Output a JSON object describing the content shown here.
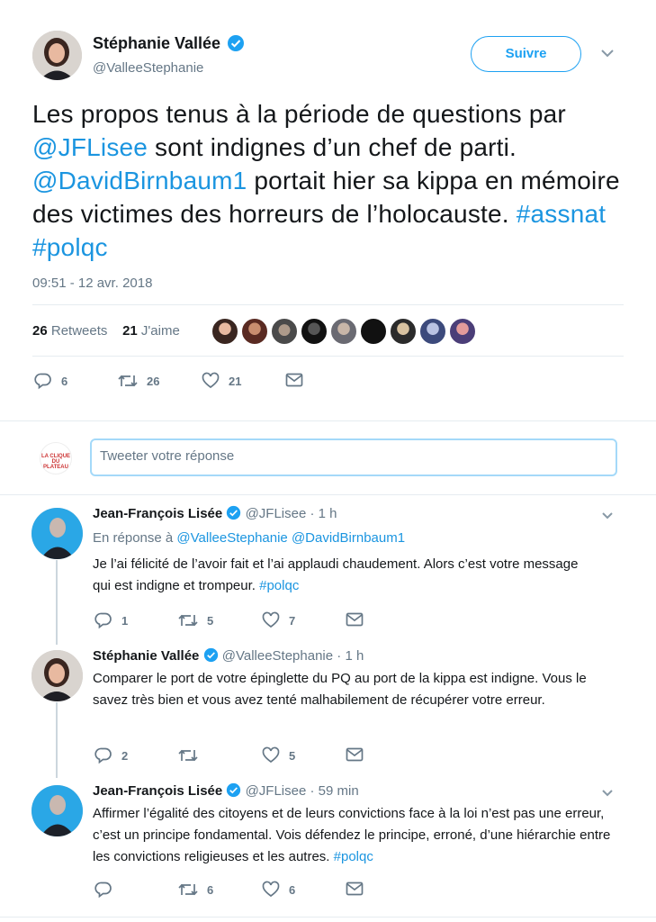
{
  "main_tweet": {
    "author_name": "Stéphanie Vallée",
    "author_handle": "@ValleeStephanie",
    "follow_label": "Suivre",
    "text_parts": [
      {
        "t": "Les propos tenus à la période de questions par ",
        "link": false
      },
      {
        "t": "@JFLisee",
        "link": true
      },
      {
        "t": " sont indignes d’un chef de parti. ",
        "link": false
      },
      {
        "t": "@DavidBirnbaum1",
        "link": true
      },
      {
        "t": " portait hier sa kippa en mémoire des victimes des horreurs de l’holocauste. ",
        "link": false
      },
      {
        "t": "#assnat",
        "link": true
      },
      {
        "t": " ",
        "link": false
      },
      {
        "t": "#polqc",
        "link": true
      }
    ],
    "timestamp": "09:51 - 12 avr. 2018",
    "retweets_count": "26",
    "retweets_label": "Retweets",
    "likes_count": "21",
    "likes_label": "J'aime",
    "actions": {
      "replies": "6",
      "retweets": "26",
      "likes": "21"
    }
  },
  "reply_composer": {
    "placeholder": "Tweeter votre réponse",
    "avatar_text": "LA CLIQUE DU PLATEAU"
  },
  "replies": [
    {
      "author_name": "Jean-François Lisée",
      "author_handle": "@JFLisee",
      "time": "· 1 h",
      "in_reply_prefix": "En réponse à",
      "in_reply_to": "@ValleeStephanie @DavidBirnbaum1",
      "text_parts": [
        {
          "t": "Je l’ai félicité de l’avoir fait et l’ai applaudi chaudement. Alors c’est votre message qui est indigne et trompeur. ",
          "link": false
        },
        {
          "t": "#polqc",
          "link": true
        }
      ],
      "actions": {
        "replies": "1",
        "retweets": "5",
        "likes": "7"
      }
    },
    {
      "author_name": "Stéphanie Vallée",
      "author_handle": "@ValleeStephanie",
      "time": "· 1 h",
      "text_parts": [
        {
          "t": "Comparer le port de votre épinglette du PQ au port de la kippa est indigne. Vous le savez très bien et vous avez tenté malhabilement de récupérer votre erreur.",
          "link": false
        }
      ],
      "actions": {
        "replies": "2",
        "retweets": "",
        "likes": "5"
      }
    },
    {
      "author_name": "Jean-François Lisée",
      "author_handle": "@JFLisee",
      "time": "· 59 min",
      "text_parts": [
        {
          "t": "Affirmer l’égalité des citoyens et de leurs convictions face à la loi n’est pas une erreur, c’est un principe fondamental. Vois défendez le principe, erroné, d’une hiérarchie entre les convictions religieuses et les autres. ",
          "link": false
        },
        {
          "t": "#polqc",
          "link": true
        }
      ],
      "actions": {
        "replies": "",
        "retweets": "6",
        "likes": "6"
      }
    }
  ],
  "colors": {
    "accent": "#1da1f2",
    "link": "#1b95e0",
    "muted": "#657786",
    "verified": "#1da1f2"
  }
}
